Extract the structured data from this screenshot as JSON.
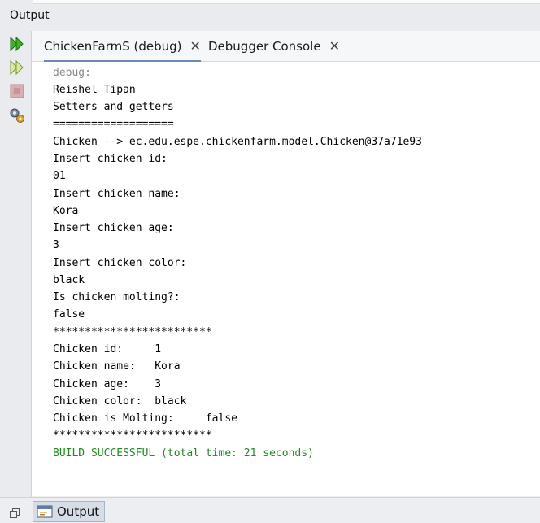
{
  "window": {
    "title": "Output"
  },
  "toolbar": {
    "rerun_icon": "rerun-icon",
    "rerun_alt_icon": "rerun-with-options-icon",
    "stop_icon": "stop-icon",
    "settings_icon": "output-settings-icon"
  },
  "tabs": [
    {
      "label": "ChickenFarmS (debug)",
      "active": true
    },
    {
      "label": "Debugger Console",
      "active": false
    }
  ],
  "console": {
    "lines": [
      {
        "text": "debug:",
        "style": "dim"
      },
      {
        "text": "Reishel Tipan",
        "style": "normal"
      },
      {
        "text": "Setters and getters",
        "style": "normal"
      },
      {
        "text": "===================",
        "style": "normal"
      },
      {
        "text": "Chicken --> ec.edu.espe.chickenfarm.model.Chicken@37a71e93",
        "style": "normal"
      },
      {
        "text": "Insert chicken id:",
        "style": "normal"
      },
      {
        "text": "01",
        "style": "normal"
      },
      {
        "text": "Insert chicken name:",
        "style": "normal"
      },
      {
        "text": "Kora",
        "style": "normal"
      },
      {
        "text": "Insert chicken age:",
        "style": "normal"
      },
      {
        "text": "3",
        "style": "normal"
      },
      {
        "text": "Insert chicken color:",
        "style": "normal"
      },
      {
        "text": "black",
        "style": "normal"
      },
      {
        "text": "Is chicken molting?:",
        "style": "normal"
      },
      {
        "text": "false",
        "style": "normal"
      },
      {
        "text": "*************************",
        "style": "normal"
      },
      {
        "text": "Chicken id:     1",
        "style": "normal"
      },
      {
        "text": "Chicken name:   Kora",
        "style": "normal"
      },
      {
        "text": "Chicken age:    3",
        "style": "normal"
      },
      {
        "text": "Chicken color:  black",
        "style": "normal"
      },
      {
        "text": "Chicken is Molting:     false",
        "style": "normal"
      },
      {
        "text": "*************************",
        "style": "normal"
      },
      {
        "text": "BUILD SUCCESSFUL (total time: 21 seconds)",
        "style": "ok"
      }
    ]
  },
  "bottom": {
    "tab_label": "Output"
  }
}
